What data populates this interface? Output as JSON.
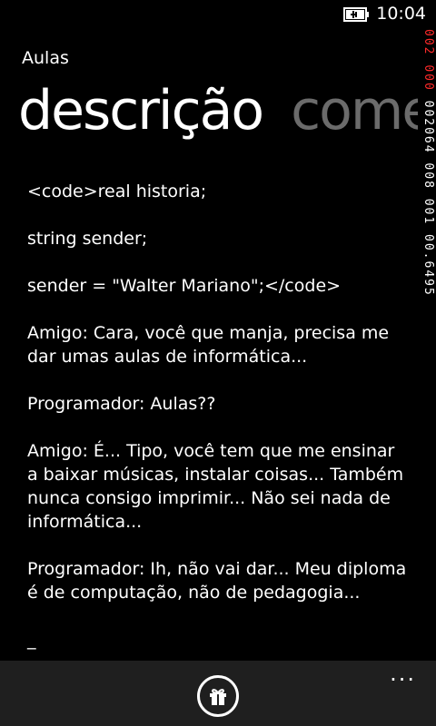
{
  "status_bar": {
    "time": "10:04",
    "battery_icon": "battery-charging-icon"
  },
  "perf_counter": {
    "fps_ui": "002",
    "fps_app": "000",
    "metrics": "002064 008 001 00.6495"
  },
  "app": {
    "title": "Aulas"
  },
  "pivot": {
    "items": [
      {
        "label": "descrição"
      },
      {
        "label": "comentários"
      }
    ]
  },
  "content": {
    "paragraphs": [
      "<code>real historia;",
      "string sender;",
      "sender = \"Walter Mariano\";</code>",
      "Amigo: Cara, você que manja, precisa me dar umas aulas de informática...",
      "Programador: Aulas??",
      "Amigo: É... Tipo, você tem que me ensinar a baixar músicas, instalar coisas... Também nunca consigo imprimir... Não sei nada de informática...",
      "Programador: Ih, não vai dar... Meu diploma é de computação, não de pedagogia...",
      "_"
    ]
  },
  "app_bar": {
    "gift_icon": "gift-icon",
    "more_label": "..."
  },
  "colors": {
    "background": "#000000",
    "app_bar": "#1f1f1f",
    "inactive_pivot": "#6b6b6b",
    "counter_red": "#ff2a2a"
  }
}
